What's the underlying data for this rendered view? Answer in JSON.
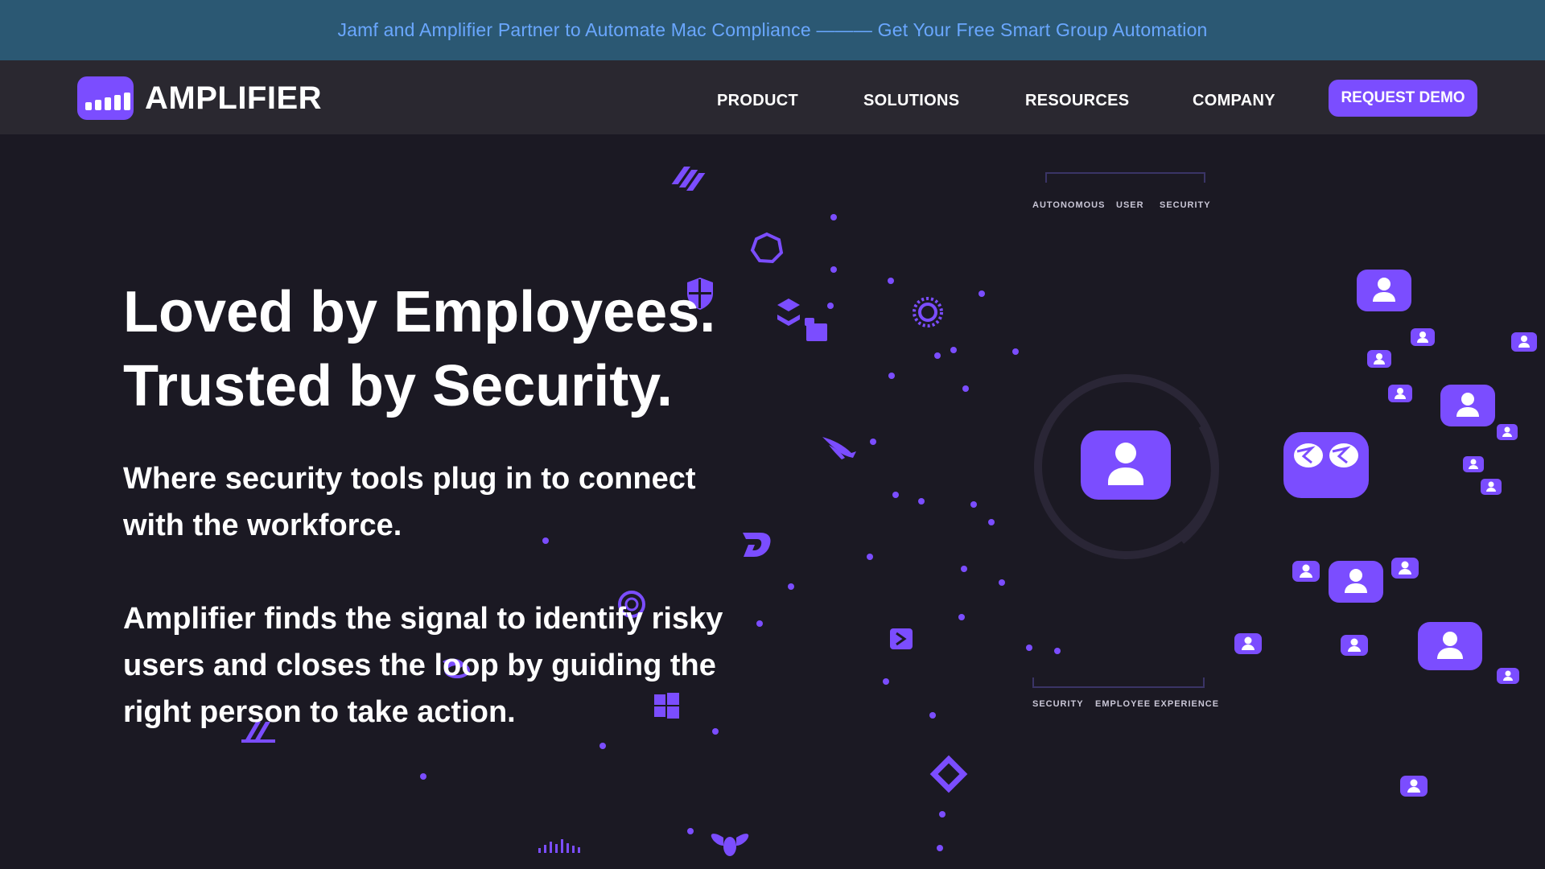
{
  "banner": {
    "text": "Jamf and Amplifier Partner to Automate Mac Compliance ——— Get Your Free Smart Group Automation"
  },
  "logo": {
    "text": "AMPLIFIER"
  },
  "nav": {
    "items": [
      {
        "label": "PRODUCT"
      },
      {
        "label": "SOLUTIONS"
      },
      {
        "label": "RESOURCES"
      },
      {
        "label": "COMPANY"
      }
    ],
    "cta": "REQUEST DEMO"
  },
  "hero": {
    "headline_line1": "Loved by Employees.",
    "headline_line2": "Trusted by Security.",
    "sub1_line1": "Where security tools plug in to connect",
    "sub1_line2": "with the workforce.",
    "sub2_line1": "Amplifier finds the signal to identify risky",
    "sub2_line2": "users and closes the loop by guiding the",
    "sub2_line3": "right person to take action."
  },
  "diagram": {
    "top_labels": [
      "AUTONOMOUS",
      "USER",
      "SECURITY"
    ],
    "bottom_labels": [
      "SECURITY",
      "EMPLOYEE EXPERIENCE"
    ]
  },
  "colors": {
    "accent": "#7b4dff",
    "background": "#1b1923",
    "banner": "#2b5873",
    "banner_text": "#6aa7ff",
    "nav": "#2a2830"
  }
}
